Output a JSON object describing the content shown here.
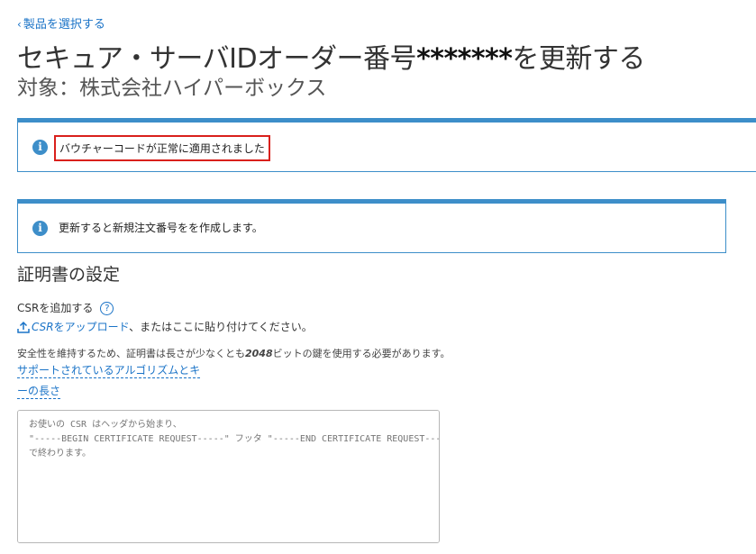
{
  "nav": {
    "back_icon": "chevron-left-icon",
    "back_label": "製品を選択する"
  },
  "header": {
    "title_prefix": "セキュア・サーバIDオーダー番号",
    "title_stars": "*******",
    "title_suffix": "を更新する",
    "subtitle": "対象：株式会社ハイパーボックス"
  },
  "notices": [
    {
      "icon": "info-icon",
      "text": "バウチャーコードが正常に適用されました"
    },
    {
      "icon": "info-icon",
      "text": "更新すると新規注文番号をを作成します。"
    }
  ],
  "certificate": {
    "section_title": "証明書の設定",
    "csr_label": "CSRを追加する",
    "help_icon": "question-circle-icon",
    "upload_icon": "upload-icon",
    "upload_link_csr": "CSR",
    "upload_link_rest": "をアップロード",
    "upload_after": "、またはここに貼り付けてください。",
    "security_before": "安全性を維持するため、証明書は長さが少なくとも",
    "security_bits": "2048",
    "security_after": "ビットの鍵を使用する必要があります。",
    "algo_link_line1": "サポートされているアルゴリズムとキ",
    "algo_link_line2": "ーの長さ",
    "csr_placeholder": "お使いの CSR はヘッダから始まり、\n\"-----BEGIN CERTIFICATE REQUEST-----\" フッタ \"-----END CERTIFICATE REQUEST-----\"\nで終わります。"
  },
  "colors": {
    "accent": "#3d8ec9",
    "link": "#1a73c7",
    "highlight_border": "#d9201c"
  }
}
